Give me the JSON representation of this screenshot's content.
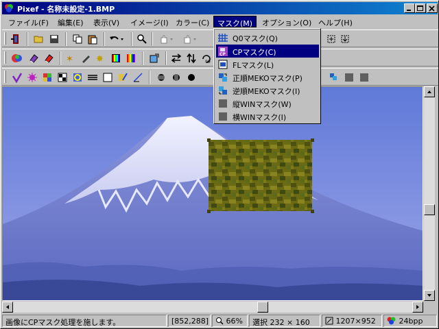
{
  "window": {
    "title": "Pixef - 名称未設定-1.BMP"
  },
  "menubar": [
    {
      "label": "ファイル(F)"
    },
    {
      "label": "編集(E)"
    },
    {
      "label": "表示(V)"
    },
    {
      "label": "イメージ(I)"
    },
    {
      "label": "カラー(C)"
    },
    {
      "label": "マスク(M)",
      "active": true
    },
    {
      "label": "オプション(O)"
    },
    {
      "label": "ヘルプ(H)"
    }
  ],
  "mask_menu": {
    "items": [
      {
        "label": "Q0マスク(Q)",
        "icon": "q0-mask-icon"
      },
      {
        "label": "CPマスク(C)",
        "icon": "cp-mask-icon",
        "selected": true
      },
      {
        "label": "FLマスク(L)",
        "icon": "fl-mask-icon"
      },
      {
        "label": "正順MEKOマスク(P)",
        "icon": "meko-forward-icon"
      },
      {
        "label": "逆順MEKOマスク(I)",
        "icon": "meko-reverse-icon"
      },
      {
        "label": "縦WINマスク(W)",
        "icon": "vertical-win-icon"
      },
      {
        "label": "横WINマスク(I)",
        "icon": "horizontal-win-icon"
      }
    ]
  },
  "status": {
    "message": "画像にCPマスク処理を施します。",
    "coords": "[852,288]",
    "zoom": "66%",
    "selection": "選択 232 × 160",
    "size": "1207×952",
    "depth": "24bpp"
  },
  "colors": {
    "titlebar": "#000080",
    "selection_highlight": "#000080",
    "sky": "#6f8ad8",
    "mask_tile": "#6b6a14"
  }
}
